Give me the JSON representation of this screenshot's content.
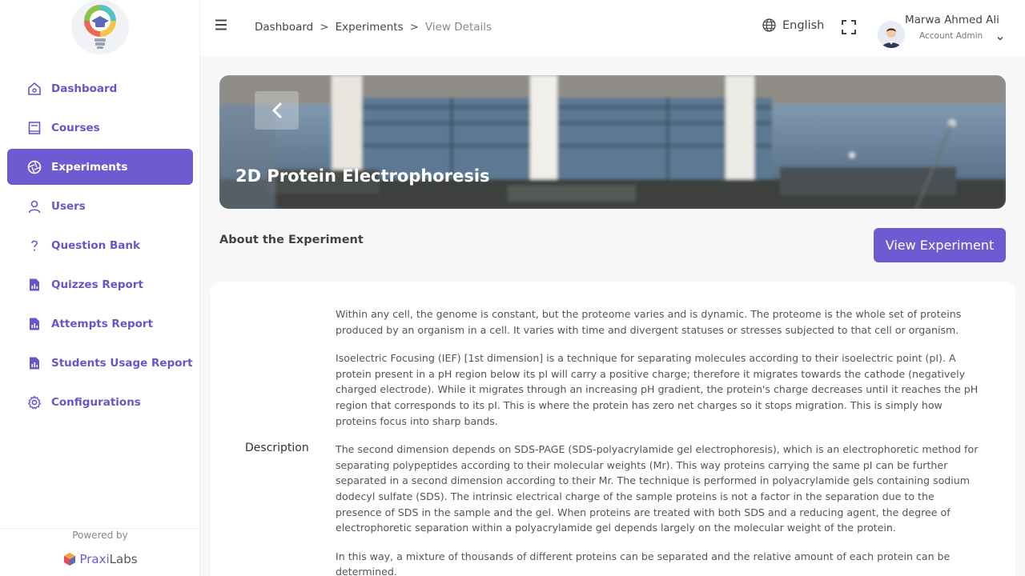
{
  "sidebar": {
    "items": [
      {
        "label": "Dashboard",
        "icon": "home-icon",
        "active": false
      },
      {
        "label": "Courses",
        "icon": "book-icon",
        "active": false
      },
      {
        "label": "Experiments",
        "icon": "aperture-icon",
        "active": true
      },
      {
        "label": "Users",
        "icon": "user-icon",
        "active": false
      },
      {
        "label": "Question Bank",
        "icon": "question-icon",
        "active": false
      },
      {
        "label": "Quizzes Report",
        "icon": "report-icon",
        "active": false
      },
      {
        "label": "Attempts Report",
        "icon": "report-icon",
        "active": false
      },
      {
        "label": "Students Usage Report",
        "icon": "report-icon",
        "active": false
      },
      {
        "label": "Configurations",
        "icon": "gear-icon",
        "active": false
      }
    ],
    "powered_by": "Powered by",
    "brand_prefix": "Praxi",
    "brand_suffix": "Labs"
  },
  "header": {
    "breadcrumbs": [
      "Dashboard",
      "Experiments",
      "View Details"
    ],
    "breadcrumb_separator": ">",
    "language": "English",
    "user_name": "Marwa Ahmed Ali",
    "user_role": "Account Admin"
  },
  "hero": {
    "title": "2D Protein Electrophoresis"
  },
  "main": {
    "section_title": "About the Experiment",
    "view_button": "View Experiment",
    "description_label": "Description",
    "description_paragraphs": [
      "Within any cell, the genome is constant, but the proteome varies and is dynamic. The proteome is the whole set of proteins produced by an organism in a cell. It varies with time and divergent statuses or stresses subjected to that cell or organism.",
      "Isoelectric Focusing (IEF) [1st dimension] is a technique for separating molecules according to their isoelectric point (pI). A protein present in a pH region below its pI will carry a positive charge; therefore it migrates towards the cathode (negatively charged electrode). While it migrates through an increasing pH gradient, the protein's charge decreases until it reaches the pH region that corresponds to its pI. This is where the protein has zero net charges so it stops migration. This is simply how proteins focus into sharp bands.",
      "The second dimension depends on SDS-PAGE (SDS-polyacrylamide gel electrophoresis), which is an electrophoretic method for separating polypeptides according to their molecular weights (Mr). This way proteins carrying the same pI can be further separated in a second dimension according to their Mr. The technique is performed in polyacrylamide gels containing sodium dodecyl sulfate (SDS). The intrinsic electrical charge of the sample proteins is not a factor in the separation due to the presence of SDS in the sample and the gel. When proteins are treated with both SDS and a reducing agent, the degree of electrophoretic separation within a polyacrylamide gel depends largely on the molecular weight of the protein.",
      "In this way, a mixture of thousands of different proteins can be separated and the relative amount of each protein can be determined."
    ]
  },
  "colors": {
    "accent": "#6e5bd1",
    "sidebar_text": "#6a54c9"
  }
}
